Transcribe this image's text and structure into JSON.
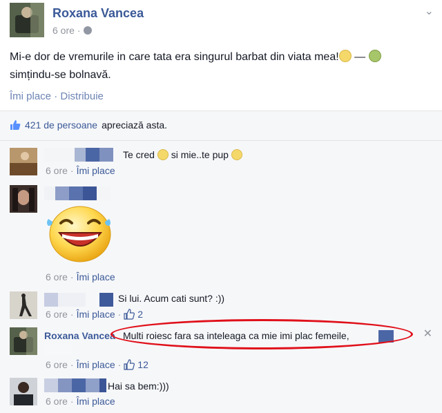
{
  "post": {
    "author": "Roxana Vancea",
    "time": "6 ore",
    "text_main": "Mi-e dor de vremurile in care tata era singurul barbat din viata mea!",
    "feeling_dash": "—",
    "feeling_text": "simțindu-se bolnavă.",
    "like_action": "Îmi place",
    "share_action": "Distribuie",
    "separator": "·",
    "menu_glyph": "⌄"
  },
  "likes": {
    "count_text": "421 de persoane",
    "suffix": "apreciază asta."
  },
  "comments": [
    {
      "text": "Te cred",
      "text2": "si mie..te pup",
      "time": "6 ore",
      "action": "Îmi place"
    },
    {
      "time": "6 ore",
      "action": "Îmi place"
    },
    {
      "text": "Si lui. Acum cati sunt? :))",
      "time": "6 ore",
      "action": "Îmi place",
      "likes": "2"
    },
    {
      "author": "Roxana Vancea",
      "text": "Multi roiesc fara sa inteleaga ca mie imi plac femeile,",
      "time": "6 ore",
      "action": "Îmi place",
      "likes": "12",
      "close": "✕"
    },
    {
      "text": "Hai sa bem:)))",
      "time": "6 ore",
      "action": "Îmi place"
    }
  ],
  "colors": {
    "link": "#3b5998",
    "meta": "#90949c",
    "highlight": "#e0101a"
  }
}
